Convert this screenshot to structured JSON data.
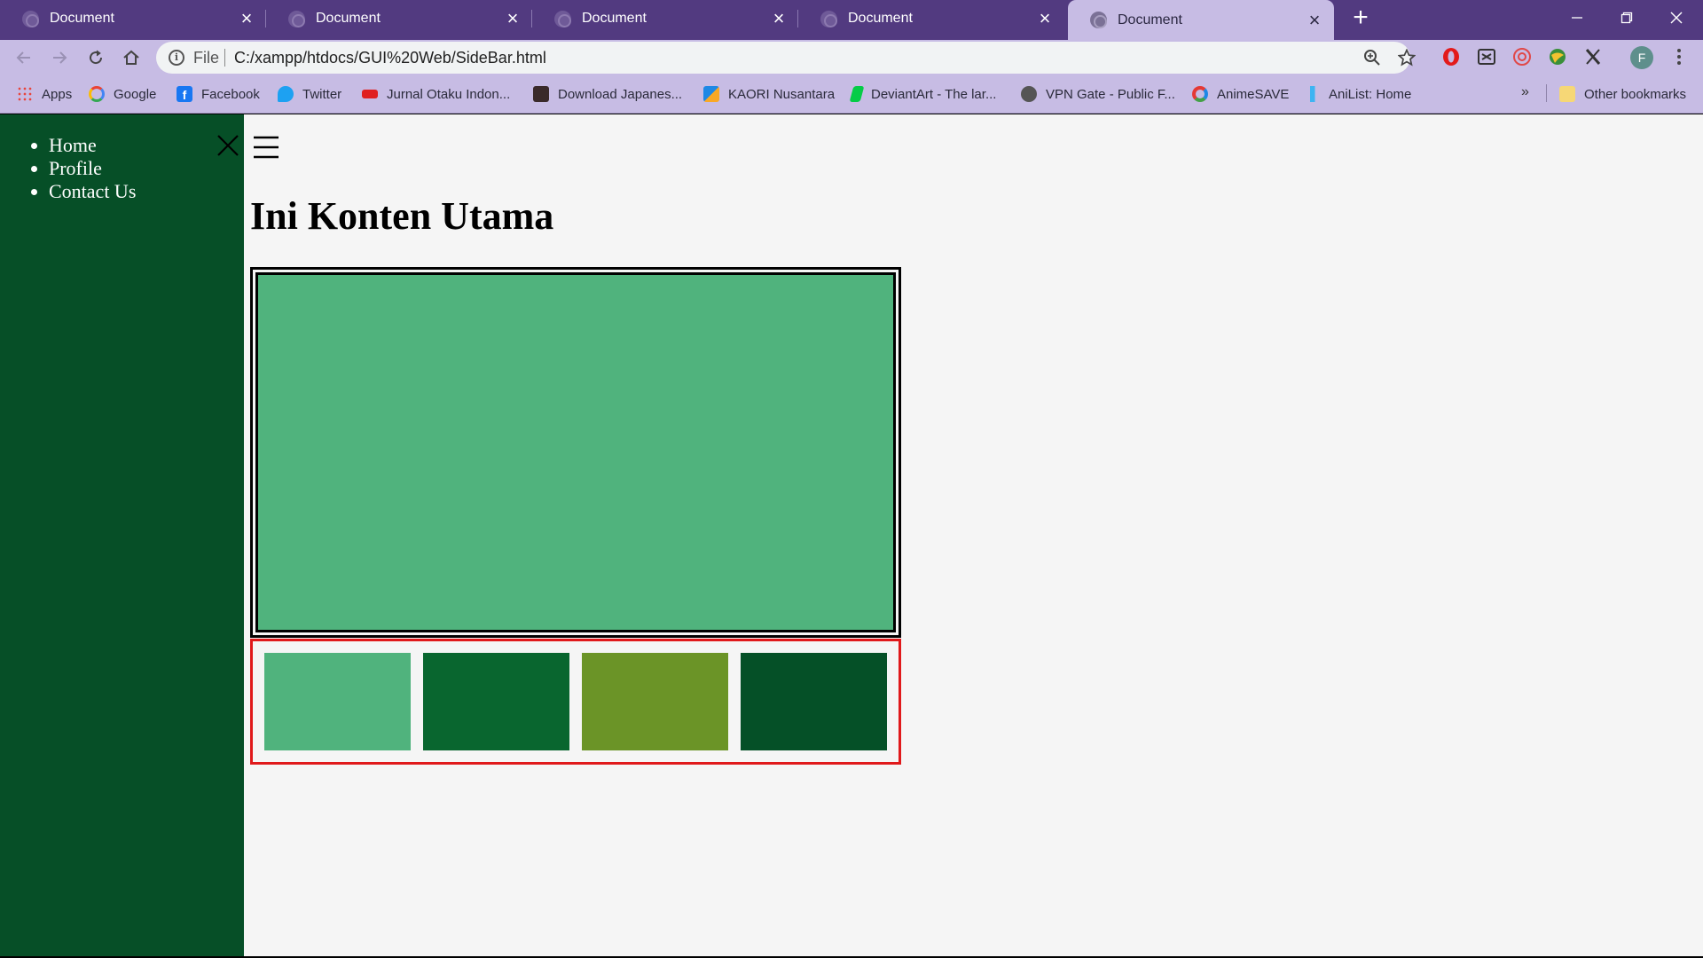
{
  "browser": {
    "tabs": [
      {
        "title": "Document",
        "active": false
      },
      {
        "title": "Document",
        "active": false
      },
      {
        "title": "Document",
        "active": false
      },
      {
        "title": "Document",
        "active": false
      },
      {
        "title": "Document",
        "active": true
      }
    ],
    "address_bar": {
      "scheme_label": "File",
      "url": "C:/xampp/htdocs/GUI%20Web/SideBar.html"
    },
    "profile_initial": "F",
    "bookmarks": [
      {
        "label": "Apps",
        "icon": "apps-grid-icon",
        "color": "#e8453c"
      },
      {
        "label": "Google",
        "icon": "google-icon",
        "color": "#4285f4"
      },
      {
        "label": "Facebook",
        "icon": "facebook-icon",
        "color": "#1877f2"
      },
      {
        "label": "Twitter",
        "icon": "twitter-icon",
        "color": "#1da1f2"
      },
      {
        "label": "Jurnal Otaku Indon...",
        "icon": "jurnal-otaku-icon",
        "color": "#e02020"
      },
      {
        "label": "Download Japanes...",
        "icon": "download-japanese-icon",
        "color": "#3a2a2a"
      },
      {
        "label": "KAORI Nusantara",
        "icon": "kaori-icon",
        "color": "#1e88e5"
      },
      {
        "label": "DeviantArt - The lar...",
        "icon": "deviantart-icon",
        "color": "#05cc47"
      },
      {
        "label": "VPN Gate - Public F...",
        "icon": "globe-icon",
        "color": "#555555"
      },
      {
        "label": "AnimeSAVE",
        "icon": "animesave-icon",
        "color": "#e53935"
      },
      {
        "label": "AniList: Home",
        "icon": "anilist-icon",
        "color": "#3db4f2"
      }
    ],
    "bookmarks_overflow": "»",
    "other_bookmarks": "Other bookmarks",
    "colors": {
      "tabstrip": "#523a80",
      "toolbar": "#c7bce4"
    }
  },
  "page": {
    "sidebar": {
      "items": [
        "Home",
        "Profile",
        "Contact Us"
      ],
      "background": "#064f27"
    },
    "heading": "Ini Konten Utama",
    "hero_color": "#50b37d",
    "thumbnails": [
      {
        "color": "#50b37d"
      },
      {
        "color": "#09662f"
      },
      {
        "color": "#6b9427"
      },
      {
        "color": "#055027"
      }
    ]
  }
}
